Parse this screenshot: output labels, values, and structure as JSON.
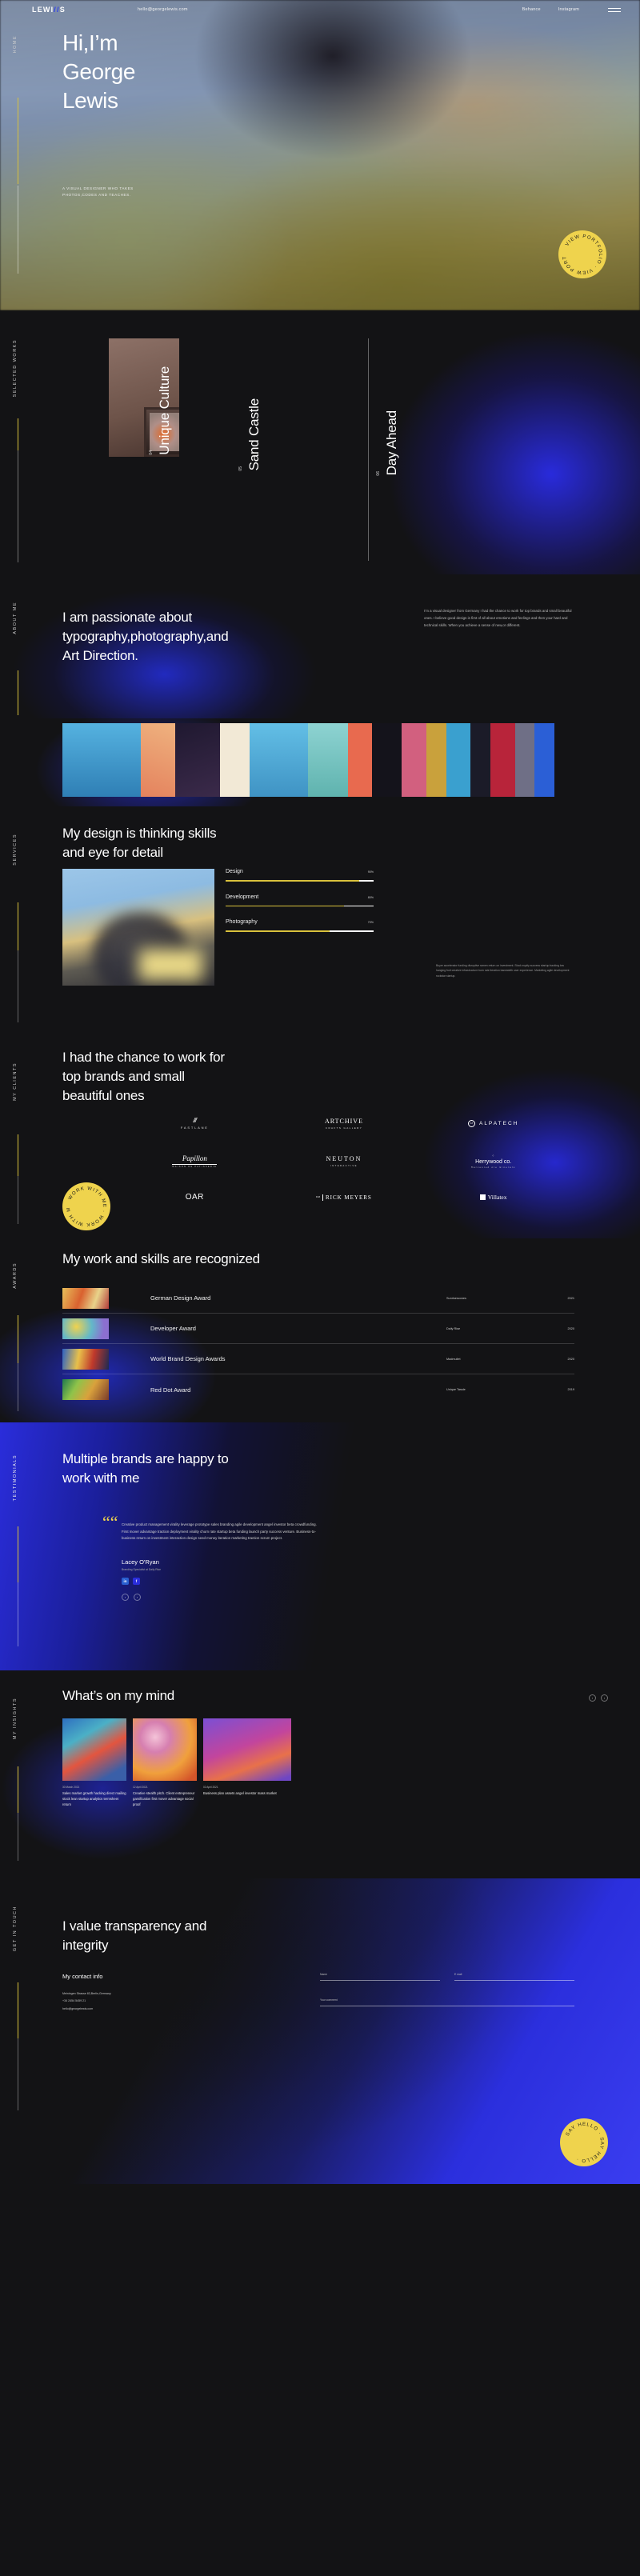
{
  "nav": {
    "logo_pre": "LEWI",
    "logo_slash": "//",
    "logo_post": "S",
    "email": "hello@georgelewis.com",
    "links": [
      {
        "label": "Behance"
      },
      {
        "label": "Instagram"
      }
    ],
    "menu_icon": "hamburger-icon"
  },
  "hero": {
    "side_label": "HOME",
    "title_line1": "Hi,I’m",
    "title_line2": "George",
    "title_line3": "Lewis",
    "subtitle_line1": "A VISUAL DESIGNER WHO TAKES",
    "subtitle_line2": "PHOTOS,CODES AND TEACHES.",
    "badge": "VIEW PORTFOLIO · VIEW PORTFOLIO ·",
    "badge_color": "#efd34d"
  },
  "works": {
    "side_label": "SELECTED WORKS",
    "items": [
      {
        "num": "04",
        "name": "Unique Culture"
      },
      {
        "num": "05",
        "name": "Sand Castle"
      },
      {
        "num": "06",
        "name": "Day Ahead"
      }
    ]
  },
  "about": {
    "side_label": "ABOUT ME",
    "heading_l1": "I am passionate about",
    "heading_l2": "typography,photography,and",
    "heading_l3": "Art Direction.",
    "paragraph": "I’m a visual designer from Germany I had the chance to work for top brands and small beautiful ones. I believe good design is first of all about emotions and feelings and then your hard and technical skills. When you achieve a sense of new,or different."
  },
  "services": {
    "side_label": "SERVICES",
    "heading_l1": "My design is thinking skills",
    "heading_l2": "and eye for detail",
    "skills": [
      {
        "name": "Design",
        "pct": "90%",
        "value": 90
      },
      {
        "name": "Development",
        "pct": "80%",
        "value": 80
      },
      {
        "name": "Photography",
        "pct": "70%",
        "value": 70
      }
    ],
    "paragraph": "Buyer accelerator funding disruptive ramen return on investment. Stock equity success startup backing low hanging fruit creative infrastructure burn rate iteration bandwidth user experience. Marketing agile development rockstar startup.",
    "bar_color": "#d9c13c"
  },
  "clients": {
    "side_label": "MY CLIENTS",
    "heading_l1": "I had the chance to work for",
    "heading_l2": "top brands and small",
    "heading_l3": "beautiful ones",
    "badge": "WORK WITH ME · WORK WITH ME ·",
    "logos": [
      {
        "main": "FASTLANE",
        "sub": "",
        "mark": "|||"
      },
      {
        "main": "ARTCHIVE",
        "sub": "CRAFTS GALLERY",
        "mark": ""
      },
      {
        "main": "ALPATECH",
        "sub": "",
        "mark": "AT"
      },
      {
        "main": "Papillon",
        "sub": "MAISON DE PATISSERIE",
        "mark": ""
      },
      {
        "main": "NEUTON",
        "sub": "INTERACTIVE",
        "mark": ""
      },
      {
        "main": "Herrywood co.",
        "sub": "Harvested ore minerals",
        "mark": ""
      },
      {
        "main": "OAR",
        "sub": "",
        "mark": ""
      },
      {
        "main": "RICK MEYERS",
        "sub": "",
        "mark": "R.M"
      },
      {
        "main": "Villatex",
        "sub": "",
        "mark": ""
      }
    ]
  },
  "awards": {
    "side_label": "AWARDS",
    "heading": "My work and skills are recognized",
    "rows": [
      {
        "name": "German Design Award",
        "client": "Sunrisescones",
        "year": "2021"
      },
      {
        "name": "Developer Award",
        "client": "Daily Rise",
        "year": "2020"
      },
      {
        "name": "World Brand Design Awards",
        "client": "Madmullet",
        "year": "2020"
      },
      {
        "name": "Red Dot Award",
        "client": "Unique Tassle",
        "year": "2019"
      }
    ]
  },
  "testimonials": {
    "side_label": "TESTIMONIALS",
    "heading_l1": "Multiple brands are happy to",
    "heading_l2": "work with me",
    "quote_mark": "“",
    "quote": "Creative product management virality leverage prototype sales branding agile development angel investor beta crowdfunding. First mover advantage traction deployment virality churn rate startup beta funding launch party success venture. Business-to-business return on investment interaction design seed money iteration marketing traction scrum project.",
    "author": "Lacey O'Ryan",
    "author_role": "Branding Specialist at Daily Rise",
    "socials": [
      {
        "icon": "linkedin-icon",
        "glyph": "in",
        "color": "#2a5fd0"
      },
      {
        "icon": "facebook-icon",
        "glyph": "f",
        "color": "#2a2ddb"
      }
    ],
    "prev": "‹",
    "next": "›"
  },
  "blog": {
    "side_label": "MY INSIGHTS",
    "heading": "What’s on my mind",
    "prev": "‹",
    "next": "›",
    "posts": [
      {
        "date": "30 March 2021",
        "title": "Sales market growth hacking direct mailing stock lean startup analytics termsheet return"
      },
      {
        "date": "12 April 2021",
        "title": "Creative stealth pitch. Client entrepreneur gamification first mover advantage social proof"
      },
      {
        "date": "02 April 2021",
        "title": "Business plan assets angel investor mass market"
      }
    ]
  },
  "contact": {
    "side_label": "GET IN TOUCH",
    "heading_l1": "I value transparency and",
    "heading_l2": "integrity",
    "subheading": "My contact info",
    "address": "Meiningen Strasse 83,Berlin,Germany",
    "phone": "+34 2454 5459 21",
    "email": "hello@georgelewis.com",
    "form": {
      "name_label": "Name",
      "email_label": "E mail",
      "message_label": "Your comment"
    },
    "badge": "SAY HELLO · SAY HELLO ·"
  }
}
